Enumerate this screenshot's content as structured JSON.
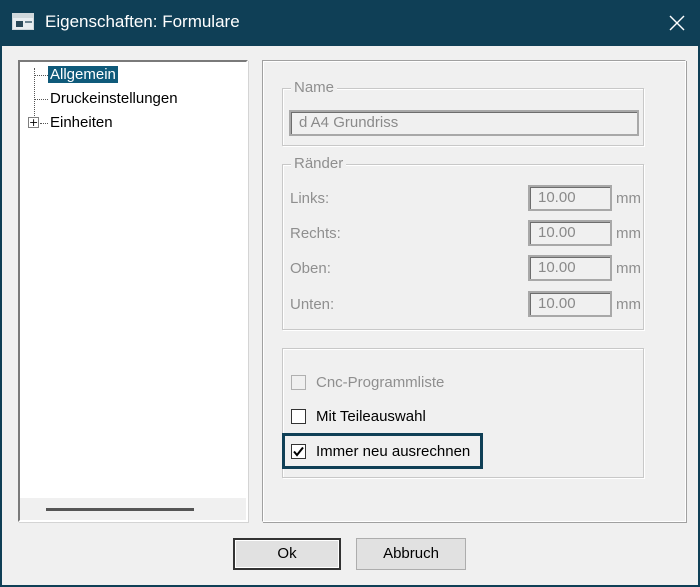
{
  "window": {
    "title": "Eigenschaften: Formulare",
    "app_icon": "form-window-icon",
    "close_icon": "close-icon"
  },
  "tree": {
    "items": [
      {
        "label": "Allgemein",
        "selected": true
      },
      {
        "label": "Druckeinstellungen",
        "selected": false
      },
      {
        "label": "Einheiten",
        "selected": false,
        "expander": "+"
      }
    ]
  },
  "name_group": {
    "title": "Name",
    "value": "d A4 Grundriss"
  },
  "margins_group": {
    "title": "Ränder",
    "rows": [
      {
        "label": "Links:",
        "value": "10.00",
        "unit": "mm"
      },
      {
        "label": "Rechts:",
        "value": "10.00",
        "unit": "mm"
      },
      {
        "label": "Oben:",
        "value": "10.00",
        "unit": "mm"
      },
      {
        "label": "Unten:",
        "value": "10.00",
        "unit": "mm"
      }
    ]
  },
  "options": {
    "items": [
      {
        "label": "Cnc-Programmliste",
        "checked": false,
        "enabled": false
      },
      {
        "label": "Mit Teileauswahl",
        "checked": false,
        "enabled": true
      },
      {
        "label": "Immer neu ausrechnen",
        "checked": true,
        "enabled": true
      }
    ]
  },
  "buttons": {
    "ok": "Ok",
    "cancel": "Abbruch"
  }
}
